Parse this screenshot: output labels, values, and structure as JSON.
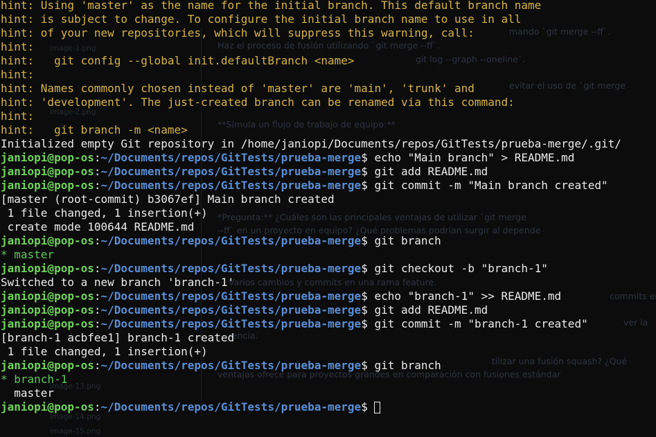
{
  "colors": {
    "background": "#0c0c0d",
    "hint": "#d7b34a",
    "prompt_user": "#6fd35a",
    "prompt_path": "#5a8fd6",
    "text": "#ececec",
    "current_branch": "#5ec75a"
  },
  "prompt": {
    "user_host": "janiopi@pop-os",
    "separator": ":",
    "path": "~/Documents/repos/GitTests/prueba-merge",
    "symbol": "$ "
  },
  "hints": [
    "hint: Using 'master' as the name for the initial branch. This default branch name",
    "hint: is subject to change. To configure the initial branch name to use in all",
    "hint: of your new repositories, which will suppress this warning, call:",
    "hint: ",
    "hint:   git config --global init.defaultBranch <name>",
    "hint: ",
    "hint: Names commonly chosen instead of 'master' are 'main', 'trunk' and",
    "hint: 'development'. The just-created branch can be renamed via this command:",
    "hint: ",
    "hint:   git branch -m <name>"
  ],
  "init_output": "Initialized empty Git repository in /home/janiopi/Documents/repos/GitTests/prueba-merge/.git/",
  "commands": [
    "echo \"Main branch\" > README.md",
    "git add README.md",
    "git commit -m \"Main branch created\"",
    "git branch",
    "git checkout -b \"branch-1\"",
    "echo \"branch-1\" >> README.md",
    "git add README.md",
    "git commit -m \"branch-1 created\"",
    "git branch",
    ""
  ],
  "outputs": {
    "commit1": [
      "[master (root-commit) b3067ef] Main branch created",
      " 1 file changed, 1 insertion(+)",
      " create mode 100644 README.md"
    ],
    "branch_list1": [
      "* master"
    ],
    "checkout": "Switched to a new branch 'branch-1'",
    "commit2": [
      "[branch-1 acbfee1] branch-1 created",
      " 1 file changed, 1 insertion(+)"
    ],
    "branch_list2_current": "* branch-1",
    "branch_list2_other": "  master"
  },
  "background_ghost": {
    "lines": [
      "Haz el proceso de fusión utilizando `git merge --ff`.",
      "mando `git merge --ff`.",
      "git log --graph --oneline`.",
      "evitar el uso de `git merge",
      "**Simula un flujo de trabajo de equipo:**",
      "*Pregunta:** ¿Cuáles son las principales ventajas de utilizar `git merge",
      "--ff` en un proyecto en equipo? ¿Qué problemas podrían surgir al depende",
      "Varios cambios y commits en una rama feature.",
      "commits en",
      "ver la",
      "rencia.",
      "tilizar una fusión squash? ¿Qué",
      "ventajas ofrece para proyectos grandes en comparación con fusiones estándar"
    ],
    "files": [
      "image-1.png",
      "image-2.png",
      "image-13.png",
      "image-14.png",
      "image-15.png"
    ]
  }
}
